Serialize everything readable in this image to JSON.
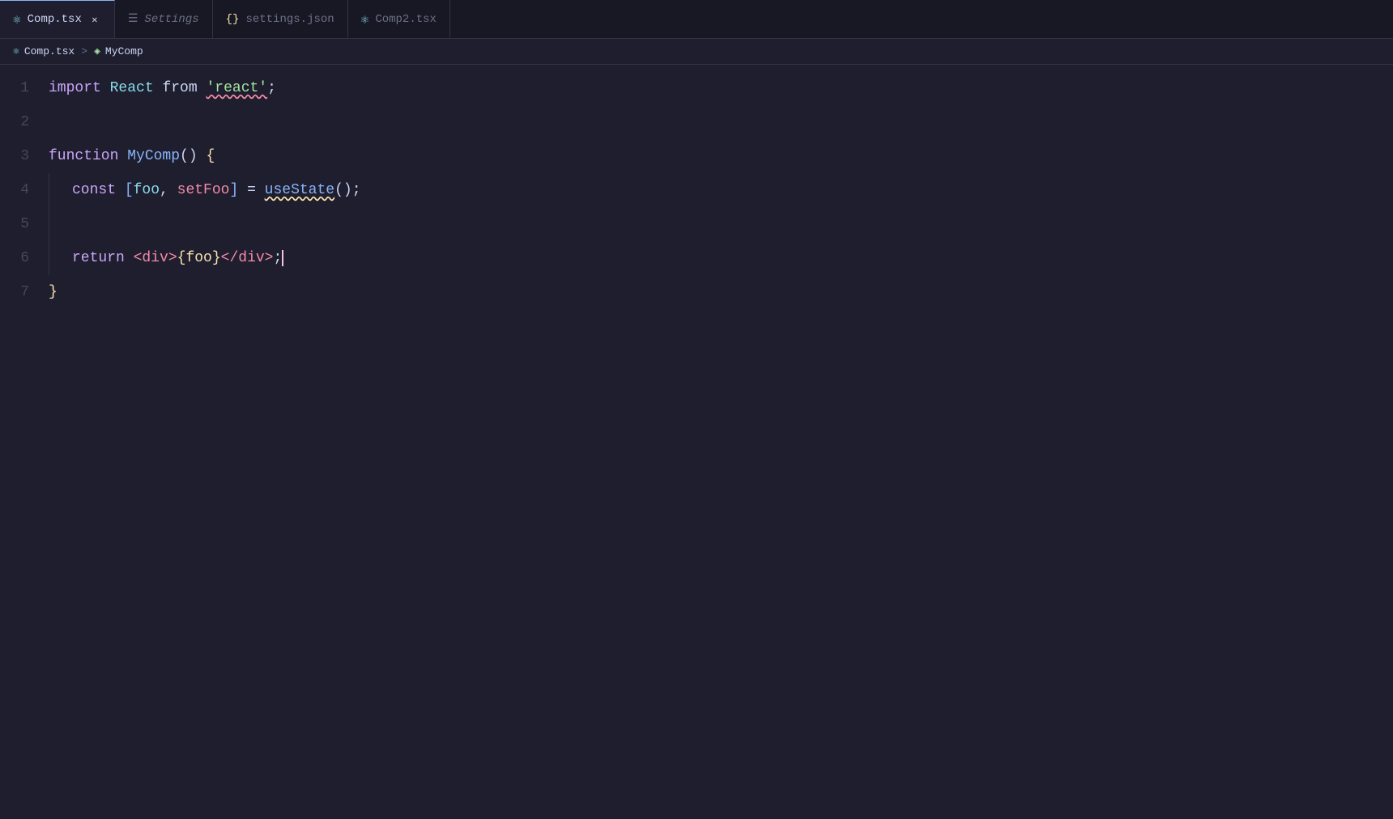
{
  "tabs": [
    {
      "id": "comp-tsx",
      "label": "Comp.tsx",
      "icon": "react",
      "active": true,
      "closable": true,
      "modified": false
    },
    {
      "id": "settings",
      "label": "Settings",
      "icon": "settings",
      "active": false,
      "closable": false,
      "italic": true
    },
    {
      "id": "settings-json",
      "label": "settings.json",
      "icon": "json",
      "active": false,
      "closable": false
    },
    {
      "id": "comp2-tsx",
      "label": "Comp2.tsx",
      "icon": "react",
      "active": false,
      "closable": false
    }
  ],
  "breadcrumb": {
    "file": "Comp.tsx",
    "separator": ">",
    "component": "MyComp"
  },
  "code": {
    "lines": [
      {
        "num": "1",
        "tokens": [
          {
            "type": "keyword",
            "text": "import "
          },
          {
            "type": "module",
            "text": "React"
          },
          {
            "type": "default",
            "text": " "
          },
          {
            "type": "default",
            "text": "from"
          },
          {
            "type": "default",
            "text": " "
          },
          {
            "type": "string_squiggly",
            "text": "'react'"
          },
          {
            "type": "default",
            "text": ";"
          }
        ]
      },
      {
        "num": "2",
        "tokens": []
      },
      {
        "num": "3",
        "tokens": [
          {
            "type": "keyword",
            "text": "function "
          },
          {
            "type": "funcname",
            "text": "MyComp"
          },
          {
            "type": "default",
            "text": "() "
          },
          {
            "type": "brace",
            "text": "{"
          }
        ]
      },
      {
        "num": "4",
        "indented": true,
        "tokens": [
          {
            "type": "keyword",
            "text": "const "
          },
          {
            "type": "bracket",
            "text": "["
          },
          {
            "type": "varname",
            "text": "foo"
          },
          {
            "type": "default",
            "text": ", "
          },
          {
            "type": "setter",
            "text": "setFoo"
          },
          {
            "type": "bracket",
            "text": "]"
          },
          {
            "type": "default",
            "text": " = "
          },
          {
            "type": "hook_squiggly",
            "text": "useState"
          },
          {
            "type": "default",
            "text": "();"
          }
        ]
      },
      {
        "num": "5",
        "indented": true,
        "tokens": []
      },
      {
        "num": "6",
        "indented": true,
        "tokens": [
          {
            "type": "keyword",
            "text": "return "
          },
          {
            "type": "tag",
            "text": "<div>"
          },
          {
            "type": "brace",
            "text": "{"
          },
          {
            "type": "foo_yellow",
            "text": "foo"
          },
          {
            "type": "brace",
            "text": "}"
          },
          {
            "type": "tag",
            "text": "</div>"
          },
          {
            "type": "default",
            "text": ";"
          }
        ]
      },
      {
        "num": "7",
        "tokens": [
          {
            "type": "brace",
            "text": "}"
          }
        ]
      }
    ]
  }
}
